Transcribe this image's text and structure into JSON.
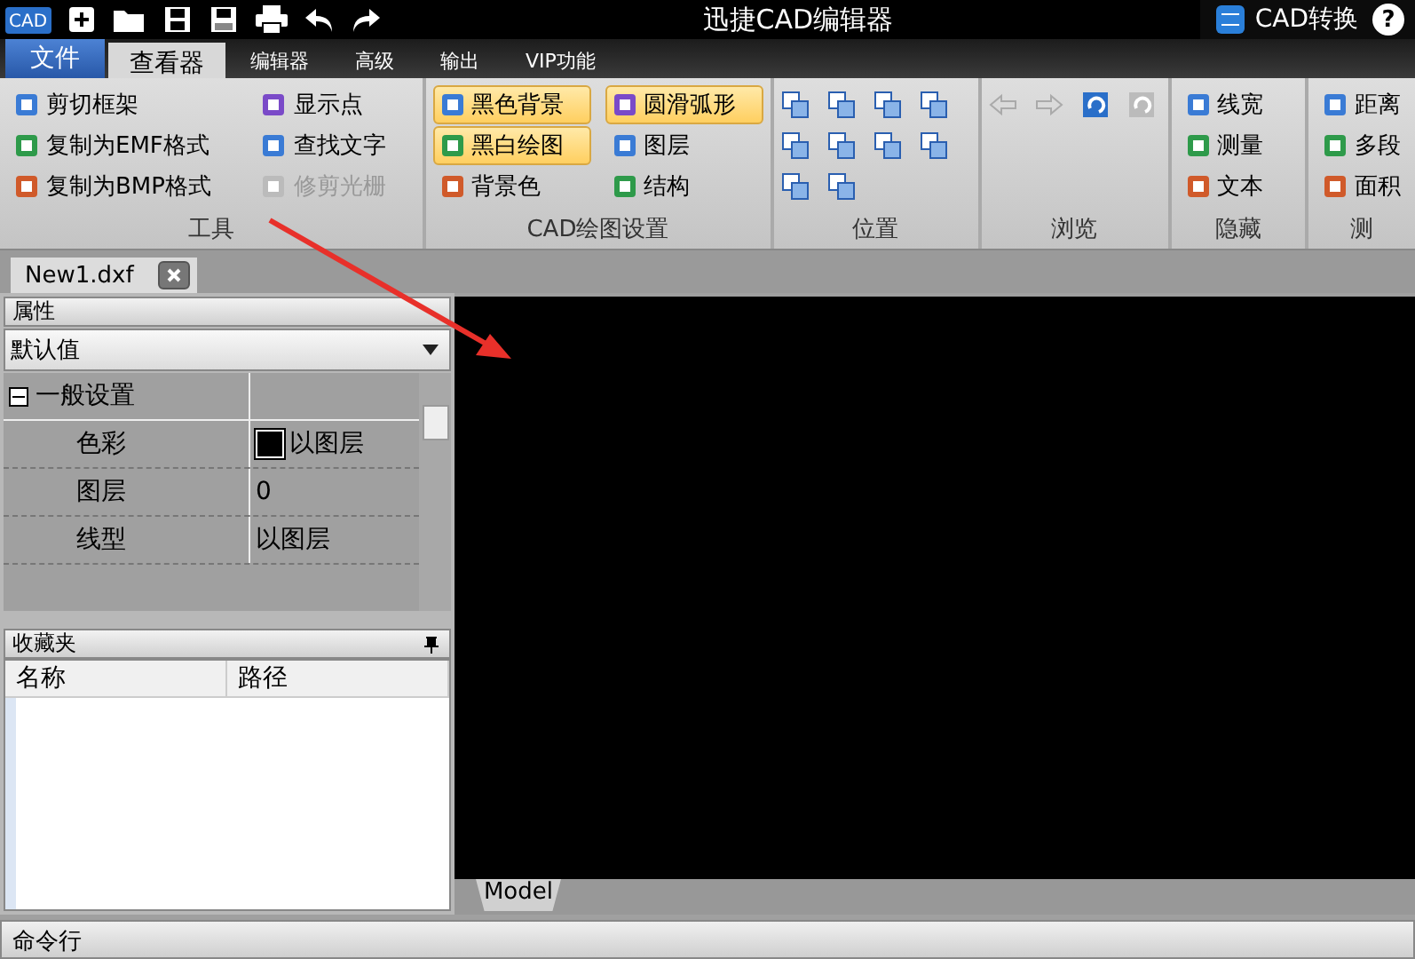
{
  "title_bar": {
    "logo": "CAD",
    "title": "迅捷CAD编辑器",
    "convert_button": "CAD转换",
    "help": "?"
  },
  "menu_tabs": [
    {
      "label": "文件",
      "kind": "file",
      "selected": false
    },
    {
      "label": "查看器",
      "kind": "tab",
      "selected": true
    },
    {
      "label": "编辑器",
      "kind": "tab",
      "selected": false
    },
    {
      "label": "高级",
      "kind": "tab",
      "selected": false
    },
    {
      "label": "输出",
      "kind": "tab",
      "selected": false
    },
    {
      "label": "VIP功能",
      "kind": "tab",
      "selected": false
    }
  ],
  "ribbon": [
    {
      "label": "工具",
      "kind": "text",
      "items": [
        {
          "label": "剪切框架",
          "disabled": false
        },
        {
          "label": "复制为EMF格式",
          "disabled": false
        },
        {
          "label": "复制为BMP格式",
          "disabled": false
        },
        {
          "label": "显示点",
          "disabled": false
        },
        {
          "label": "查找文字",
          "disabled": false
        },
        {
          "label": "修剪光栅",
          "disabled": true
        }
      ]
    },
    {
      "label": "CAD绘图设置",
      "kind": "toggles",
      "items": [
        {
          "label": "黑色背景",
          "selected": true
        },
        {
          "label": "黑白绘图",
          "selected": true
        },
        {
          "label": "背景色",
          "selected": false
        },
        {
          "label": "圆滑弧形",
          "selected": true
        },
        {
          "label": "图层",
          "selected": false
        },
        {
          "label": "结构",
          "selected": false
        }
      ]
    },
    {
      "label": "位置",
      "kind": "position"
    },
    {
      "label": "浏览",
      "kind": "browse"
    },
    {
      "label": "隐藏",
      "kind": "text",
      "items": [
        {
          "label": "线宽",
          "disabled": false
        },
        {
          "label": "测量",
          "disabled": false
        },
        {
          "label": "文本",
          "disabled": false
        }
      ]
    },
    {
      "label": "测",
      "kind": "text",
      "items": [
        {
          "label": "距离",
          "disabled": false
        },
        {
          "label": "多段",
          "disabled": false
        },
        {
          "label": "面积",
          "disabled": false
        }
      ]
    }
  ],
  "document_tab": "New1.dxf",
  "properties": {
    "title": "属性",
    "preset": "默认值",
    "category": {
      "label": "一般设置",
      "expanded": true
    },
    "rows": [
      {
        "name": "色彩",
        "value": "以图层",
        "color": "#000000"
      },
      {
        "name": "图层",
        "value": "0"
      },
      {
        "name": "线型",
        "value": "以图层"
      }
    ]
  },
  "favorites": {
    "title": "收藏夹",
    "columns": [
      "名称",
      "路径"
    ]
  },
  "model_tab": "Model",
  "command_line": "命令行"
}
